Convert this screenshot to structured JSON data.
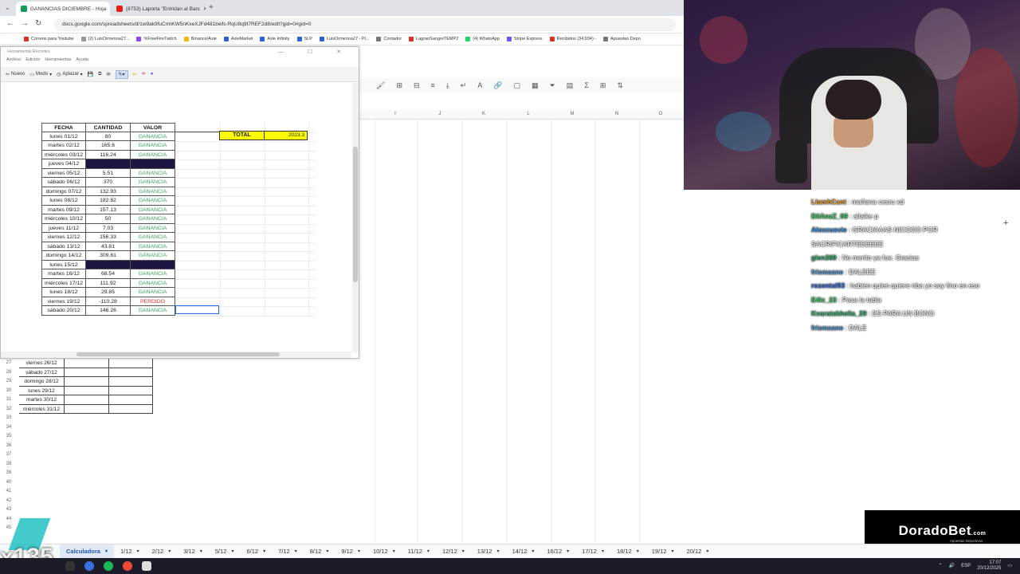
{
  "browser": {
    "tabs": [
      {
        "title": "GANANCIAS DICIEMBRE - Hoja"
      },
      {
        "title": "(8753) Laporta \"Entridan al Barc"
      }
    ],
    "url": "docs.google.com/spreadsheets/d/1w9ak9fuCrmKW5nKxeXJFd481bwfc-RqU8q9t7REF2d8/edit?gid=0#gid=0",
    "bookmarks": [
      {
        "label": "Correos para Youtube",
        "color": "#d93025"
      },
      {
        "label": "(2) LuisOrmenoa27...",
        "color": "#999"
      },
      {
        "label": "%FreeFireTwitch",
        "color": "#9146ff"
      },
      {
        "label": "Binance/Axie",
        "color": "#f0b90b"
      },
      {
        "label": "AxieMarket",
        "color": "#2a62d8"
      },
      {
        "label": "Axie Infinity",
        "color": "#2a62d8"
      },
      {
        "label": "SLP",
        "color": "#2a62d8"
      },
      {
        "label": "LuisOrmenoa27 - Pl...",
        "color": "#2a62d8"
      },
      {
        "label": "Contador",
        "color": "#777"
      },
      {
        "label": "LagranSangreTEMP2",
        "color": "#d93025"
      },
      {
        "label": "(4) WhatsApp",
        "color": "#25d366"
      },
      {
        "label": "Stripe Express",
        "color": "#635bff"
      },
      {
        "label": "Recibidos (34,934) -",
        "color": "#d93025"
      },
      {
        "label": "Apuestas Depo",
        "color": "#777"
      }
    ]
  },
  "window": {
    "title": "Herramienta Recortes",
    "controls": "— ☐ ✕",
    "menu": [
      "Archivo",
      "Edición",
      "Herramientas",
      "Ayuda"
    ],
    "toolbar": {
      "new": "Nuevo",
      "mode": "Modo",
      "delay": "Aplazar"
    }
  },
  "table": {
    "headers": [
      "FECHA",
      "CANTIDAD",
      "VALOR"
    ],
    "rows": [
      {
        "fecha": "lunes 01/12",
        "cantidad": "80",
        "valor": "GANANCIA",
        "type": "gan"
      },
      {
        "fecha": "martes 02/12",
        "cantidad": "165.6",
        "valor": "GANANCIA",
        "type": "gan"
      },
      {
        "fecha": "miércoles 03/12",
        "cantidad": "116.24",
        "valor": "GANANCIA",
        "type": "gan"
      },
      {
        "fecha": "jueves 04/12",
        "cantidad": "",
        "valor": "",
        "type": "dark"
      },
      {
        "fecha": "viernes 05/12",
        "cantidad": "5.51",
        "valor": "GANANCIA",
        "type": "gan"
      },
      {
        "fecha": "sábado 06/12",
        "cantidad": "370",
        "valor": "GANANCIA",
        "type": "gan"
      },
      {
        "fecha": "domingo 07/12",
        "cantidad": "132.93",
        "valor": "GANANCIA",
        "type": "gan"
      },
      {
        "fecha": "lunes 08/12",
        "cantidad": "182.82",
        "valor": "GANANCIA",
        "type": "gan"
      },
      {
        "fecha": "martes 09/12",
        "cantidad": "157.13",
        "valor": "GANANCIA",
        "type": "gan"
      },
      {
        "fecha": "miércoles 10/12",
        "cantidad": "50",
        "valor": "GANANCIA",
        "type": "gan"
      },
      {
        "fecha": "jueves 11/12",
        "cantidad": "7.03",
        "valor": "GANANCIA",
        "type": "gan"
      },
      {
        "fecha": "viernes 12/12",
        "cantidad": "156.33",
        "valor": "GANANCIA",
        "type": "gan"
      },
      {
        "fecha": "sábado 13/12",
        "cantidad": "43.81",
        "valor": "GANANCIA",
        "type": "gan"
      },
      {
        "fecha": "domingo 14/12",
        "cantidad": "309.61",
        "valor": "GANANCIA",
        "type": "gan"
      },
      {
        "fecha": "lunes 15/12",
        "cantidad": "",
        "valor": "",
        "type": "dark"
      },
      {
        "fecha": "martes 16/12",
        "cantidad": "68.54",
        "valor": "GANANCIA",
        "type": "gan"
      },
      {
        "fecha": "miércoles 17/12",
        "cantidad": "111.92",
        "valor": "GANANCIA",
        "type": "gan"
      },
      {
        "fecha": "lunes 18/12",
        "cantidad": "29.85",
        "valor": "GANANCIA",
        "type": "gan"
      },
      {
        "fecha": "viernes 19/12",
        "cantidad": "-110.28",
        "valor": "PERDIDO",
        "type": "per"
      },
      {
        "fecha": "sábado 20/12",
        "cantidad": "146.26",
        "valor": "GANANCIA",
        "type": "gan"
      }
    ],
    "total_label": "TOTAL",
    "total_value": "2023.3"
  },
  "lower_sheet": {
    "rows": [
      {
        "num": "27",
        "fecha": "viernes 26/12"
      },
      {
        "num": "28",
        "fecha": "sábado 27/12"
      },
      {
        "num": "29",
        "fecha": "domingo 28/12"
      },
      {
        "num": "30",
        "fecha": "lunes 29/12"
      },
      {
        "num": "31",
        "fecha": "martes 30/12"
      },
      {
        "num": "32",
        "fecha": "miércoles 31/12"
      }
    ],
    "empty_rows": [
      "33",
      "34",
      "35",
      "36",
      "37",
      "38",
      "39",
      "40",
      "41",
      "42",
      "43",
      "44",
      "45"
    ],
    "columns": [
      "I",
      "J",
      "K",
      "L",
      "M",
      "N",
      "O"
    ]
  },
  "chat": [
    {
      "user": "LlamhCant",
      "color": "#e8a33a",
      "text": "mañana cesru xd"
    },
    {
      "user": "DiiAnzZ_69",
      "color": "#44cc66",
      "text": "aliaike p"
    },
    {
      "user": "Alexcusvie",
      "color": "#3a8fe0",
      "text": "GRACIAAAS NICOOO POR SACRIFICARTEEEEEE"
    },
    {
      "user": "glen369",
      "color": "#3cb371",
      "text": "No merito ya fue. Gracias"
    },
    {
      "user": "frismaane",
      "color": "#5a9bd5",
      "text": "DALEEE"
    },
    {
      "user": "rozental93",
      "color": "#3a6fe0",
      "text": "habien quien quiere nba yo soy fino en eso"
    },
    {
      "user": "E4ic_23",
      "color": "#44cc66",
      "text": "Pasa la tabla"
    },
    {
      "user": "Kvaratskhelia_29",
      "color": "#3cb371",
      "text": "ES PARA UN BONO"
    },
    {
      "user": "frismaane",
      "color": "#5a9bd5",
      "text": "DALE"
    }
  ],
  "logo": {
    "text": "DoradoBet",
    "suffix": ".com",
    "sub": "Apuestas Deportivas"
  },
  "sheet_tabs": [
    "Calculadora",
    "1/12",
    "2/12",
    "3/12",
    "5/12",
    "6/12",
    "7/12",
    "8/12",
    "9/12",
    "10/12",
    "11/12",
    "12/12",
    "13/12",
    "14/12",
    "16/12",
    "17/12",
    "18/12",
    "19/12",
    "20/12"
  ],
  "overlay_counter": "x135",
  "taskbar": {
    "lang": "ESP",
    "time": "17:07",
    "date": "20/12/2025"
  }
}
